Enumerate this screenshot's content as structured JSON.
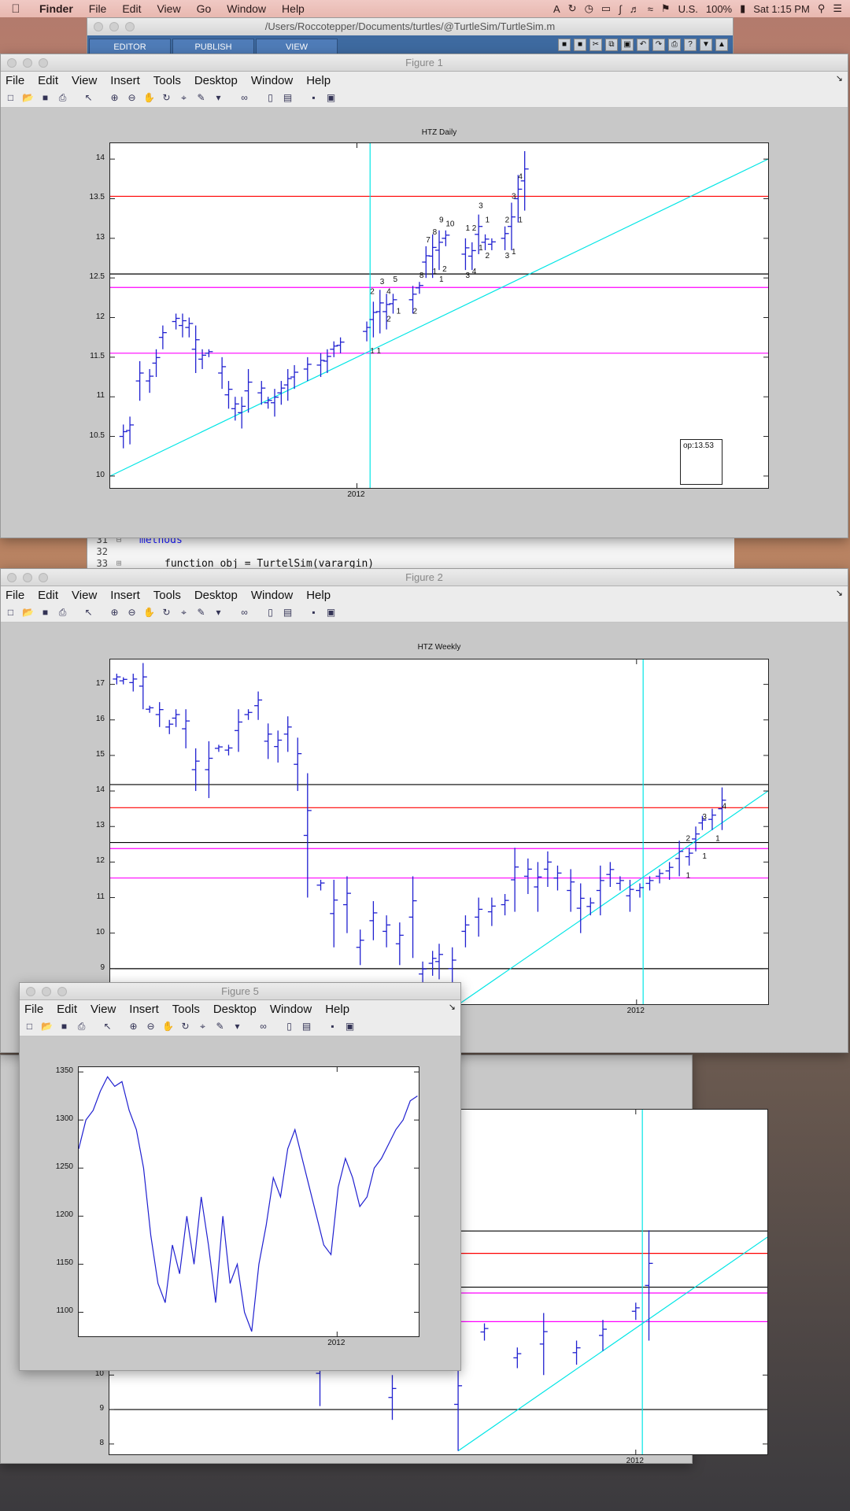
{
  "menubar": {
    "items": [
      "Finder",
      "File",
      "Edit",
      "View",
      "Go",
      "Window",
      "Help"
    ],
    "status": {
      "input": "U.S.",
      "battery": "100%",
      "clock": "Sat 1:15 PM"
    }
  },
  "editor": {
    "title": "/Users/Roccotepper/Documents/turtles/@TurtleSim/TurtleSim.m",
    "tabs": [
      "EDITOR",
      "PUBLISH",
      "VIEW"
    ],
    "code": [
      {
        "ln": "31",
        "text": "methods"
      },
      {
        "ln": "32",
        "text": ""
      },
      {
        "ln": "33",
        "text": "function obj = TurtelSim(varargin)"
      }
    ]
  },
  "figure_menu": [
    "File",
    "Edit",
    "View",
    "Insert",
    "Tools",
    "Desktop",
    "Window",
    "Help"
  ],
  "colors": {
    "bars": "#2020d0",
    "cyan": "#00e5e5",
    "red": "#ff0000",
    "magenta": "#ff00ff",
    "black": "#000000"
  },
  "figure1": {
    "title": "Figure 1"
  },
  "figure2": {
    "title": "Figure 2"
  },
  "figure5": {
    "title": "Figure 5"
  },
  "chart_data": [
    {
      "id": "htz-daily",
      "type": "bar",
      "title": "HTZ Daily",
      "ylim": [
        9.85,
        14.2
      ],
      "yticks": [
        10,
        10.5,
        11,
        11.5,
        12,
        12.5,
        13,
        13.5,
        14
      ],
      "xticks": [
        "2012"
      ],
      "hlines": [
        {
          "y": 13.53,
          "color": "#ff0000"
        },
        {
          "y": 12.55,
          "color": "#000000"
        },
        {
          "y": 12.38,
          "color": "#ff00ff"
        },
        {
          "y": 11.55,
          "color": "#ff00ff"
        }
      ],
      "trendline": {
        "from": [
          0,
          10.0
        ],
        "to": [
          1,
          14.0
        ]
      },
      "vline_x": 0.395,
      "annotation": "op:13.53",
      "bars": [
        [
          0.02,
          10.35,
          10.65
        ],
        [
          0.03,
          10.4,
          10.75
        ],
        [
          0.045,
          10.95,
          11.45
        ],
        [
          0.06,
          11.05,
          11.35
        ],
        [
          0.07,
          11.25,
          11.6
        ],
        [
          0.08,
          11.6,
          11.9
        ],
        [
          0.1,
          11.85,
          12.05
        ],
        [
          0.11,
          11.75,
          12.05
        ],
        [
          0.12,
          11.75,
          12.0
        ],
        [
          0.13,
          11.3,
          11.9
        ],
        [
          0.14,
          11.35,
          11.6
        ],
        [
          0.15,
          11.5,
          11.6
        ],
        [
          0.17,
          11.1,
          11.5
        ],
        [
          0.18,
          10.85,
          11.2
        ],
        [
          0.19,
          10.7,
          11.0
        ],
        [
          0.2,
          10.6,
          11.0
        ],
        [
          0.21,
          10.8,
          11.35
        ],
        [
          0.23,
          10.9,
          11.2
        ],
        [
          0.24,
          10.85,
          11.0
        ],
        [
          0.25,
          10.75,
          11.1
        ],
        [
          0.26,
          10.9,
          11.2
        ],
        [
          0.27,
          10.95,
          11.35
        ],
        [
          0.28,
          11.1,
          11.4
        ],
        [
          0.3,
          11.2,
          11.5
        ],
        [
          0.32,
          11.25,
          11.55
        ],
        [
          0.33,
          11.3,
          11.6
        ],
        [
          0.34,
          11.5,
          11.7
        ],
        [
          0.35,
          11.55,
          11.75
        ],
        [
          0.39,
          11.7,
          11.95
        ],
        [
          0.4,
          11.75,
          12.2
        ],
        [
          0.41,
          11.8,
          12.35
        ],
        [
          0.42,
          11.85,
          12.3
        ],
        [
          0.43,
          12.05,
          12.3
        ],
        [
          0.46,
          12.05,
          12.4
        ],
        [
          0.47,
          12.3,
          12.45
        ],
        [
          0.48,
          12.5,
          12.9
        ],
        [
          0.49,
          12.5,
          13.05
        ],
        [
          0.5,
          12.6,
          13.1
        ],
        [
          0.51,
          12.9,
          13.1
        ],
        [
          0.54,
          12.6,
          13.0
        ],
        [
          0.55,
          12.6,
          12.95
        ],
        [
          0.56,
          12.8,
          13.3
        ],
        [
          0.57,
          12.85,
          13.05
        ],
        [
          0.58,
          12.85,
          13.0
        ],
        [
          0.6,
          12.85,
          13.15
        ],
        [
          0.61,
          12.85,
          13.45
        ],
        [
          0.62,
          13.2,
          13.8
        ],
        [
          0.63,
          13.35,
          14.1
        ]
      ],
      "labels": [
        [
          0.395,
          11.55,
          "1 1"
        ],
        [
          0.395,
          12.3,
          "2"
        ],
        [
          0.41,
          12.42,
          "3"
        ],
        [
          0.42,
          12.3,
          "4"
        ],
        [
          0.43,
          12.45,
          "5"
        ],
        [
          0.42,
          11.95,
          "2"
        ],
        [
          0.435,
          12.05,
          "1"
        ],
        [
          0.46,
          12.05,
          "2"
        ],
        [
          0.47,
          12.5,
          "8"
        ],
        [
          0.48,
          12.95,
          "7"
        ],
        [
          0.49,
          13.05,
          "8"
        ],
        [
          0.5,
          13.2,
          "9"
        ],
        [
          0.51,
          13.15,
          "10"
        ],
        [
          0.49,
          12.55,
          "1"
        ],
        [
          0.5,
          12.45,
          "1"
        ],
        [
          0.505,
          12.58,
          "2"
        ],
        [
          0.54,
          13.1,
          "1"
        ],
        [
          0.55,
          13.1,
          "2"
        ],
        [
          0.56,
          13.38,
          "3"
        ],
        [
          0.57,
          13.2,
          "1"
        ],
        [
          0.54,
          12.5,
          "3"
        ],
        [
          0.55,
          12.55,
          "4"
        ],
        [
          0.56,
          12.85,
          "1"
        ],
        [
          0.57,
          12.75,
          "2"
        ],
        [
          0.6,
          12.75,
          "3"
        ],
        [
          0.61,
          12.8,
          "1"
        ],
        [
          0.6,
          13.2,
          "2"
        ],
        [
          0.61,
          13.5,
          "3"
        ],
        [
          0.62,
          13.75,
          "4"
        ],
        [
          0.63,
          14.25,
          "5"
        ],
        [
          0.62,
          13.2,
          "1"
        ]
      ]
    },
    {
      "id": "htz-weekly",
      "type": "bar",
      "title": "HTZ Weekly",
      "ylim": [
        8.0,
        17.7
      ],
      "yticks": [
        9,
        10,
        11,
        12,
        13,
        14,
        15,
        16,
        17
      ],
      "xticks": [
        "2012"
      ],
      "hlines": [
        {
          "y": 14.18,
          "color": "#000000"
        },
        {
          "y": 13.53,
          "color": "#ff0000"
        },
        {
          "y": 12.55,
          "color": "#000000"
        },
        {
          "y": 12.38,
          "color": "#ff00ff"
        },
        {
          "y": 11.55,
          "color": "#ff00ff"
        },
        {
          "y": 9.0,
          "color": "#000000"
        }
      ],
      "trendline": {
        "from": [
          0.53,
          8.0
        ],
        "to": [
          1,
          14.0
        ]
      },
      "vline_x": 0.81,
      "bars": [
        [
          0.01,
          17.0,
          17.3
        ],
        [
          0.02,
          17.0,
          17.2
        ],
        [
          0.035,
          16.8,
          17.3
        ],
        [
          0.05,
          16.3,
          17.6
        ],
        [
          0.06,
          16.2,
          16.4
        ],
        [
          0.075,
          15.8,
          16.5
        ],
        [
          0.09,
          15.6,
          16.0
        ],
        [
          0.1,
          15.8,
          16.3
        ],
        [
          0.115,
          15.2,
          16.3
        ],
        [
          0.13,
          14.0,
          15.2
        ],
        [
          0.15,
          13.8,
          15.4
        ],
        [
          0.165,
          15.1,
          15.3
        ],
        [
          0.18,
          15.0,
          15.3
        ],
        [
          0.195,
          15.1,
          16.3
        ],
        [
          0.21,
          16.0,
          16.3
        ],
        [
          0.225,
          16.0,
          16.8
        ],
        [
          0.24,
          14.9,
          15.9
        ],
        [
          0.255,
          14.8,
          15.7
        ],
        [
          0.27,
          15.1,
          16.1
        ],
        [
          0.285,
          14.0,
          15.5
        ],
        [
          0.3,
          11.0,
          14.5
        ],
        [
          0.32,
          11.2,
          11.5
        ],
        [
          0.34,
          9.6,
          11.5
        ],
        [
          0.36,
          10.0,
          11.6
        ],
        [
          0.38,
          9.1,
          10.1
        ],
        [
          0.4,
          9.8,
          10.9
        ],
        [
          0.42,
          9.6,
          10.5
        ],
        [
          0.44,
          9.1,
          10.3
        ],
        [
          0.46,
          9.3,
          11.6
        ],
        [
          0.475,
          8.5,
          9.2
        ],
        [
          0.49,
          8.8,
          9.5
        ],
        [
          0.5,
          8.7,
          9.7
        ],
        [
          0.52,
          8.4,
          9.6
        ],
        [
          0.54,
          9.6,
          10.5
        ],
        [
          0.56,
          9.9,
          11.0
        ],
        [
          0.58,
          10.2,
          11.0
        ],
        [
          0.6,
          10.5,
          11.1
        ],
        [
          0.615,
          10.6,
          12.4
        ],
        [
          0.635,
          11.1,
          12.1
        ],
        [
          0.65,
          10.6,
          12.0
        ],
        [
          0.665,
          11.3,
          12.3
        ],
        [
          0.68,
          11.2,
          11.9
        ],
        [
          0.7,
          10.6,
          11.8
        ],
        [
          0.715,
          10.0,
          11.4
        ],
        [
          0.73,
          10.5,
          11.0
        ],
        [
          0.745,
          10.5,
          11.9
        ],
        [
          0.76,
          11.3,
          12.0
        ],
        [
          0.775,
          11.2,
          11.6
        ],
        [
          0.79,
          10.6,
          11.5
        ],
        [
          0.805,
          11.0,
          11.4
        ],
        [
          0.82,
          11.2,
          11.6
        ],
        [
          0.835,
          11.4,
          11.8
        ],
        [
          0.85,
          11.5,
          12.0
        ],
        [
          0.865,
          11.6,
          12.6
        ],
        [
          0.88,
          11.9,
          12.4
        ],
        [
          0.89,
          12.3,
          13.0
        ],
        [
          0.9,
          12.9,
          13.3
        ],
        [
          0.915,
          12.9,
          13.5
        ],
        [
          0.93,
          12.9,
          14.1
        ]
      ],
      "labels": [
        [
          0.875,
          11.55,
          "1"
        ],
        [
          0.875,
          12.6,
          "2"
        ],
        [
          0.9,
          12.1,
          "1"
        ],
        [
          0.9,
          13.2,
          "3"
        ],
        [
          0.92,
          12.6,
          "1"
        ],
        [
          0.93,
          13.5,
          "4"
        ]
      ]
    },
    {
      "id": "figure5-series",
      "type": "line",
      "title": "",
      "ylim": [
        1075,
        1355
      ],
      "yticks": [
        1100,
        1150,
        1200,
        1250,
        1300,
        1350
      ],
      "xticks": [
        "2012"
      ],
      "x": [
        0.0,
        0.02,
        0.04,
        0.06,
        0.08,
        0.1,
        0.12,
        0.14,
        0.16,
        0.18,
        0.2,
        0.22,
        0.24,
        0.26,
        0.28,
        0.3,
        0.32,
        0.34,
        0.36,
        0.38,
        0.4,
        0.42,
        0.44,
        0.46,
        0.48,
        0.5,
        0.52,
        0.54,
        0.56,
        0.58,
        0.6,
        0.62,
        0.64,
        0.66,
        0.68,
        0.7,
        0.72,
        0.74,
        0.76,
        0.78,
        0.8,
        0.82,
        0.84,
        0.86,
        0.88,
        0.9,
        0.92,
        0.94
      ],
      "y": [
        1270,
        1300,
        1310,
        1330,
        1345,
        1335,
        1340,
        1310,
        1290,
        1250,
        1180,
        1130,
        1110,
        1170,
        1140,
        1200,
        1150,
        1220,
        1170,
        1110,
        1200,
        1130,
        1150,
        1100,
        1080,
        1150,
        1190,
        1240,
        1220,
        1270,
        1290,
        1260,
        1230,
        1200,
        1170,
        1160,
        1230,
        1260,
        1240,
        1210,
        1220,
        1250,
        1260,
        1275,
        1290,
        1300,
        1320,
        1325
      ]
    },
    {
      "id": "figure-bottom",
      "type": "bar",
      "title": "",
      "ylim": [
        7.7,
        17.7
      ],
      "yticks": [
        8,
        9,
        10
      ],
      "xticks": [
        "2012"
      ],
      "hlines": [
        {
          "y": 14.18,
          "color": "#000000"
        },
        {
          "y": 13.53,
          "color": "#ff0000"
        },
        {
          "y": 12.55,
          "color": "#000000"
        },
        {
          "y": 12.38,
          "color": "#ff00ff"
        },
        {
          "y": 11.55,
          "color": "#ff00ff"
        },
        {
          "y": 9.0,
          "color": "#000000"
        }
      ],
      "trendline": {
        "from": [
          0.53,
          7.8
        ],
        "to": [
          1,
          14.0
        ]
      },
      "vline_x": 0.81,
      "bars": [
        [
          0.32,
          9.1,
          11.0
        ],
        [
          0.43,
          8.7,
          10.0
        ],
        [
          0.53,
          7.8,
          10.5
        ],
        [
          0.57,
          11.0,
          11.5
        ],
        [
          0.62,
          10.2,
          10.8
        ],
        [
          0.66,
          10.0,
          11.8
        ],
        [
          0.71,
          10.3,
          11.0
        ],
        [
          0.75,
          10.7,
          11.6
        ],
        [
          0.8,
          11.6,
          12.1
        ],
        [
          0.82,
          11.0,
          14.2
        ]
      ]
    }
  ]
}
